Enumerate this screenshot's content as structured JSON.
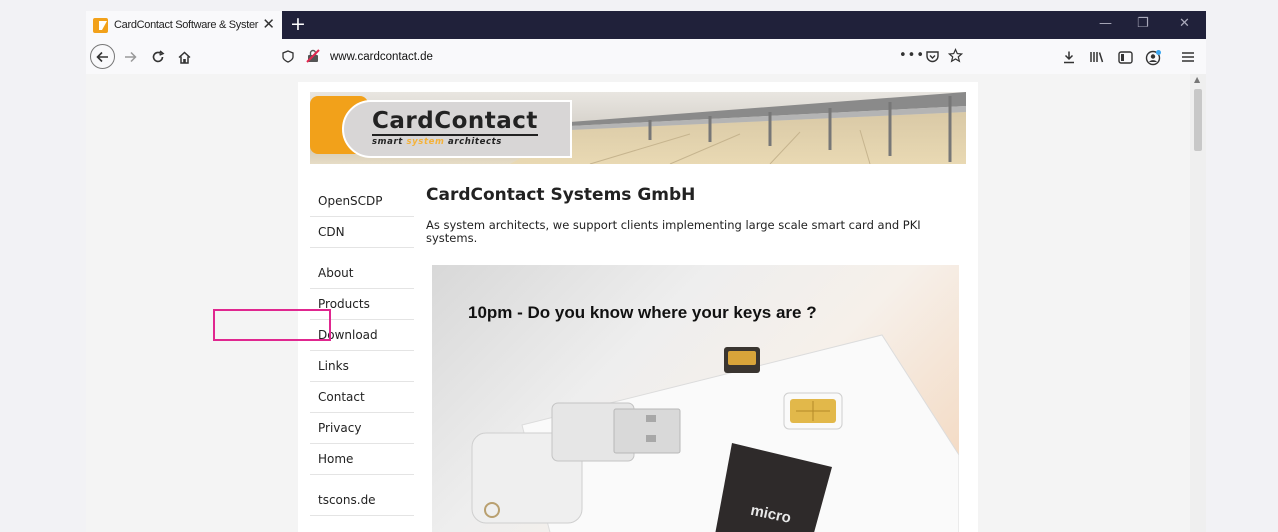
{
  "browser": {
    "tab_title": "CardContact Software & Syster",
    "url": "www.cardcontact.de"
  },
  "page": {
    "logo": {
      "name": "CardContact",
      "tagline_1": "smart",
      "tagline_2": "system",
      "tagline_3": "architects"
    },
    "nav_items": [
      "OpenSCDP",
      "CDN",
      "About",
      "Products",
      "Download",
      "Links",
      "Contact",
      "Privacy",
      "Home",
      "tscons.de"
    ],
    "title": "CardContact Systems GmbH",
    "description": "As system architects, we support clients implementing large scale smart card and PKI systems.",
    "hero_caption": "10pm - Do you know where your keys are ?",
    "hero_card_label": "micro SD"
  },
  "colors": {
    "tab_strip": "#20213a",
    "highlight": "#e0268f",
    "logo_orange": "#f2a11a"
  }
}
